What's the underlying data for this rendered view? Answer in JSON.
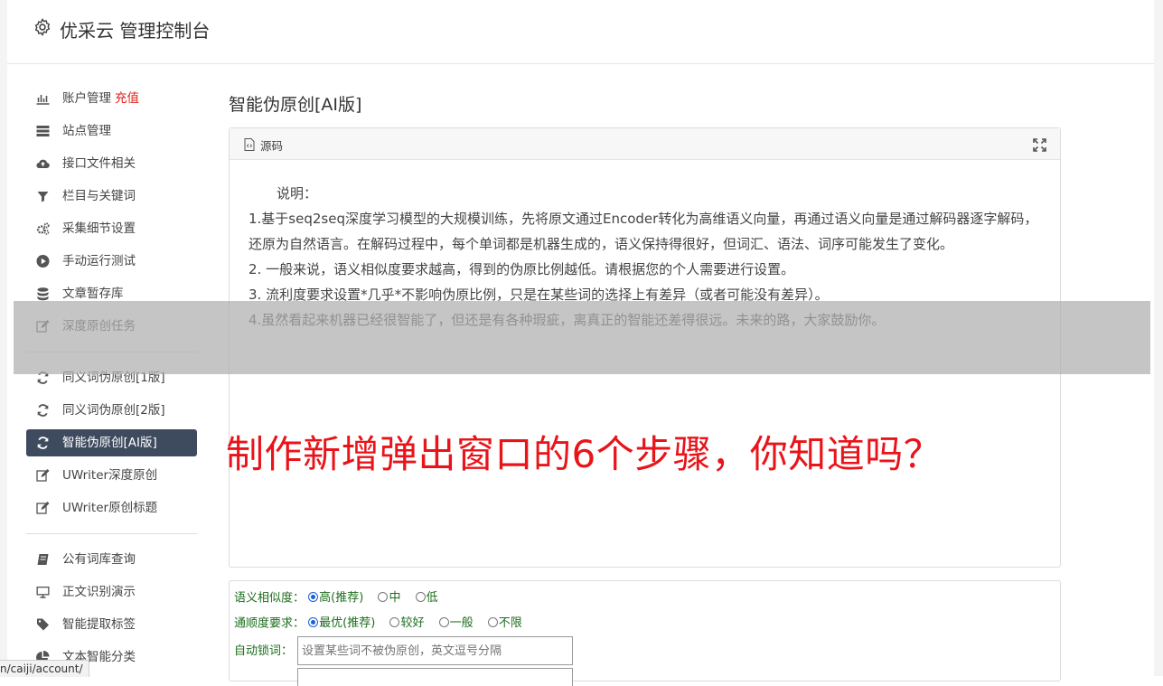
{
  "header": {
    "title": "优采云 管理控制台"
  },
  "sidebar": {
    "items": [
      {
        "label": "账户管理",
        "accent": "充值",
        "icon": "bar-chart-icon"
      },
      {
        "label": "站点管理",
        "icon": "server-icon"
      },
      {
        "label": "接口文件相关",
        "icon": "cloud-upload-icon"
      },
      {
        "label": "栏目与关键词",
        "icon": "filter-icon"
      },
      {
        "label": "采集细节设置",
        "icon": "gears-icon"
      },
      {
        "label": "手动运行测试",
        "icon": "play-circle-icon"
      },
      {
        "label": "文章暂存库",
        "icon": "database-icon"
      },
      {
        "label": "深度原创任务",
        "icon": "edit-icon"
      },
      {
        "label": "同义词伪原创[1版]",
        "icon": "refresh-icon"
      },
      {
        "label": "同义词伪原创[2版]",
        "icon": "refresh-icon"
      },
      {
        "label": "智能伪原创[AI版]",
        "icon": "refresh-icon",
        "active": true
      },
      {
        "label": "UWriter深度原创",
        "icon": "edit-icon"
      },
      {
        "label": "UWriter原创标题",
        "icon": "edit-icon"
      },
      {
        "label": "公有词库查询",
        "icon": "book-icon"
      },
      {
        "label": "正文识别演示",
        "icon": "monitor-icon"
      },
      {
        "label": "智能提取标签",
        "icon": "tag-icon"
      },
      {
        "label": "文本智能分类",
        "icon": "pie-chart-icon"
      }
    ]
  },
  "main": {
    "title": "智能伪原创[AI版]",
    "editor": {
      "source_label": "源码",
      "intro": "说明：",
      "lines": [
        "1.基于seq2seq深度学习模型的大规模训练，先将原文通过Encoder转化为高维语义向量，再通过语义向量是通过解码器逐字解码，还原为自然语言。在解码过程中，每个单词都是机器生成的，语义保持得很好，但词汇、语法、词序可能发生了变化。",
        "2. 一般来说，语义相似度要求越高，得到的伪原比例越低。请根据您的个人需要进行设置。",
        "3. 流利度要求设置*几乎*不影响伪原比例，只是在某些词的选择上有差异（或者可能没有差异）。",
        "4.虽然看起来机器已经很智能了，但还是有各种瑕疵，离真正的智能还差得很远。未来的路，大家鼓励你。"
      ]
    },
    "options": {
      "similarity": {
        "label": "语义相似度：",
        "choices": [
          "高(推荐)",
          "中",
          "低"
        ],
        "selected": 0
      },
      "fluency": {
        "label": "通顺度要求：",
        "choices": [
          "最优(推荐)",
          "较好",
          "一般",
          "不限"
        ],
        "selected": 0
      },
      "lock": {
        "label": "自动锁词：",
        "placeholder": "设置某些词不被伪原创，英文逗号分隔"
      }
    }
  },
  "overlay": {
    "text": "制作新增弹出窗口的6个步骤，你知道吗？"
  },
  "statusbar": {
    "url": "n/caiji/account/"
  },
  "colors": {
    "active_nav": "#3e4a5e",
    "accent_red": "#e0201a",
    "option_green": "#1d6e1d",
    "overlay_red": "#e8141a"
  }
}
